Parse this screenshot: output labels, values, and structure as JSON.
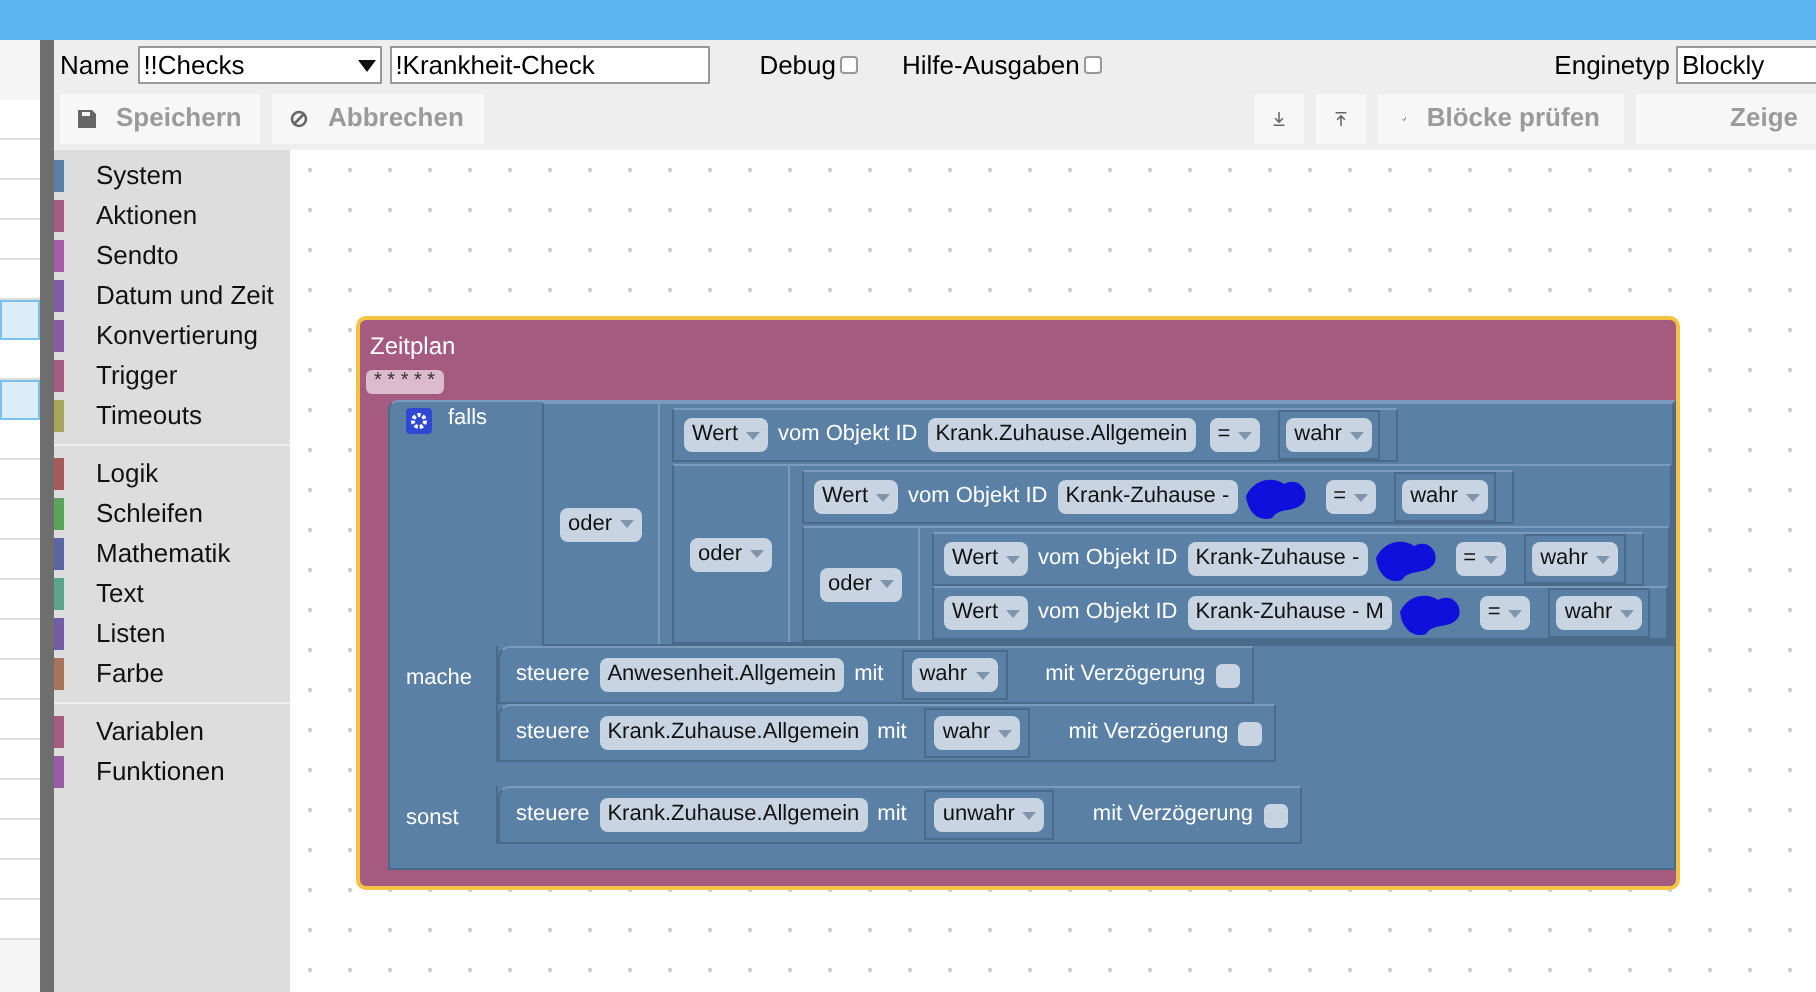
{
  "header": {
    "name_label": "Name",
    "script_select": "!!Checks",
    "name_field": "!Krankheit-Check",
    "debug": {
      "label": "Debug",
      "checked": false
    },
    "help": {
      "label": "Hilfe-Ausgaben",
      "checked": false
    },
    "engine_label": "Enginetyp",
    "engine_select": "Blockly"
  },
  "toolbar": {
    "save": "Speichern",
    "cancel": "Abbrechen",
    "check": "Blöcke prüfen",
    "show": "Zeige"
  },
  "side_list": {
    "rows": [
      {
        "selected": false
      },
      {
        "selected": false
      },
      {
        "selected": false
      },
      {
        "selected": false
      },
      {
        "selected": false
      },
      {
        "selected": true
      },
      {
        "selected": false
      },
      {
        "selected": true
      },
      {
        "selected": false
      },
      {
        "selected": false
      },
      {
        "selected": false
      },
      {
        "selected": false
      },
      {
        "selected": false
      },
      {
        "selected": false
      },
      {
        "selected": false
      },
      {
        "selected": false
      },
      {
        "selected": false
      },
      {
        "selected": false
      },
      {
        "selected": false
      },
      {
        "selected": false
      },
      {
        "selected": false
      }
    ]
  },
  "categories": [
    [
      {
        "label": "System",
        "color": "#5b80a5"
      },
      {
        "label": "Aktionen",
        "color": "#a55b80"
      },
      {
        "label": "Sendto",
        "color": "#a55ba5"
      },
      {
        "label": "Datum und Zeit",
        "color": "#805ba5"
      },
      {
        "label": "Konvertierung",
        "color": "#8a5ba5"
      },
      {
        "label": "Trigger",
        "color": "#a55b80"
      },
      {
        "label": "Timeouts",
        "color": "#a5a55b"
      }
    ],
    [
      {
        "label": "Logik",
        "color": "#a55b5b"
      },
      {
        "label": "Schleifen",
        "color": "#5ba55b"
      },
      {
        "label": "Mathematik",
        "color": "#5b67a5"
      },
      {
        "label": "Text",
        "color": "#5ba58c"
      },
      {
        "label": "Listen",
        "color": "#745ba5"
      },
      {
        "label": "Farbe",
        "color": "#a5745b"
      }
    ],
    [
      {
        "label": "Variablen",
        "color": "#a55b80"
      },
      {
        "label": "Funktionen",
        "color": "#995ba5"
      }
    ]
  ],
  "schedule": {
    "title": "Zeitplan",
    "cron": "* * * * *",
    "selected": true,
    "if": {
      "if_label": "falls",
      "do_label": "mache",
      "else_label": "sonst",
      "condition": {
        "kind": "or",
        "op": "oder",
        "children": [
          {
            "kind": "compare",
            "mode": "Wert",
            "label": "vom Objekt ID",
            "id": "Krank.Zuhause.Allgemein",
            "redacted": false,
            "op": "=",
            "value": "wahr"
          },
          {
            "kind": "or",
            "op": "oder",
            "children": [
              {
                "kind": "compare",
                "mode": "Wert",
                "label": "vom Objekt ID",
                "id": "Krank-Zuhause -",
                "redacted": true,
                "op": "=",
                "value": "wahr"
              },
              {
                "kind": "or",
                "op": "oder",
                "children": [
                  {
                    "kind": "compare",
                    "mode": "Wert",
                    "label": "vom Objekt ID",
                    "id": "Krank-Zuhause -",
                    "redacted": true,
                    "op": "=",
                    "value": "wahr"
                  },
                  {
                    "kind": "compare",
                    "mode": "Wert",
                    "label": "vom Objekt ID",
                    "id": "Krank-Zuhause - M",
                    "redacted": true,
                    "op": "=",
                    "value": "wahr"
                  }
                ]
              }
            ]
          }
        ]
      },
      "do": [
        {
          "verb": "steuere",
          "id": "Anwesenheit.Allgemein",
          "with": "mit",
          "value": "wahr",
          "delay_label": "mit Verzögerung",
          "delay": false
        },
        {
          "verb": "steuere",
          "id": "Krank.Zuhause.Allgemein",
          "with": "mit",
          "value": "wahr",
          "delay_label": "mit Verzögerung",
          "delay": false
        }
      ],
      "else": [
        {
          "verb": "steuere",
          "id": "Krank.Zuhause.Allgemein",
          "with": "mit",
          "value": "unwahr",
          "delay_label": "mit Verzögerung",
          "delay": false
        }
      ]
    }
  }
}
